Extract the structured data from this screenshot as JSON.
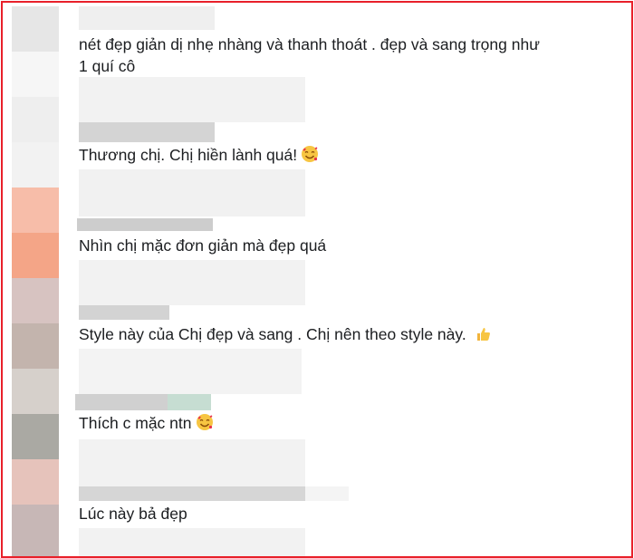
{
  "comments": [
    {
      "lines": [
        "nét đẹp giản dị nhẹ nhàng và thanh thoát . đẹp và sang trọng như",
        "1 quí cô"
      ],
      "emoji": ""
    },
    {
      "lines": [
        "Thương chị. Chị hiền lành quá!"
      ],
      "emoji": "smiling-face-with-hearts-icon"
    },
    {
      "lines": [
        "Nhìn chị mặc đơn giản mà đẹp quá"
      ],
      "emoji": ""
    },
    {
      "lines": [
        "Style này của Chị đẹp và sang . Chị nên theo style này."
      ],
      "emoji": "thumbs-up-icon"
    },
    {
      "lines": [
        "Thích c mặc ntn"
      ],
      "emoji": "smiling-face-with-hearts-icon"
    },
    {
      "lines": [
        "Lúc này bả đẹp"
      ],
      "emoji": ""
    }
  ],
  "colors": {
    "frame_border": "#e8202a",
    "text": "#1c1e21",
    "blur_light": "#f0f0f0",
    "blur_mid": "#cfcfcf"
  }
}
